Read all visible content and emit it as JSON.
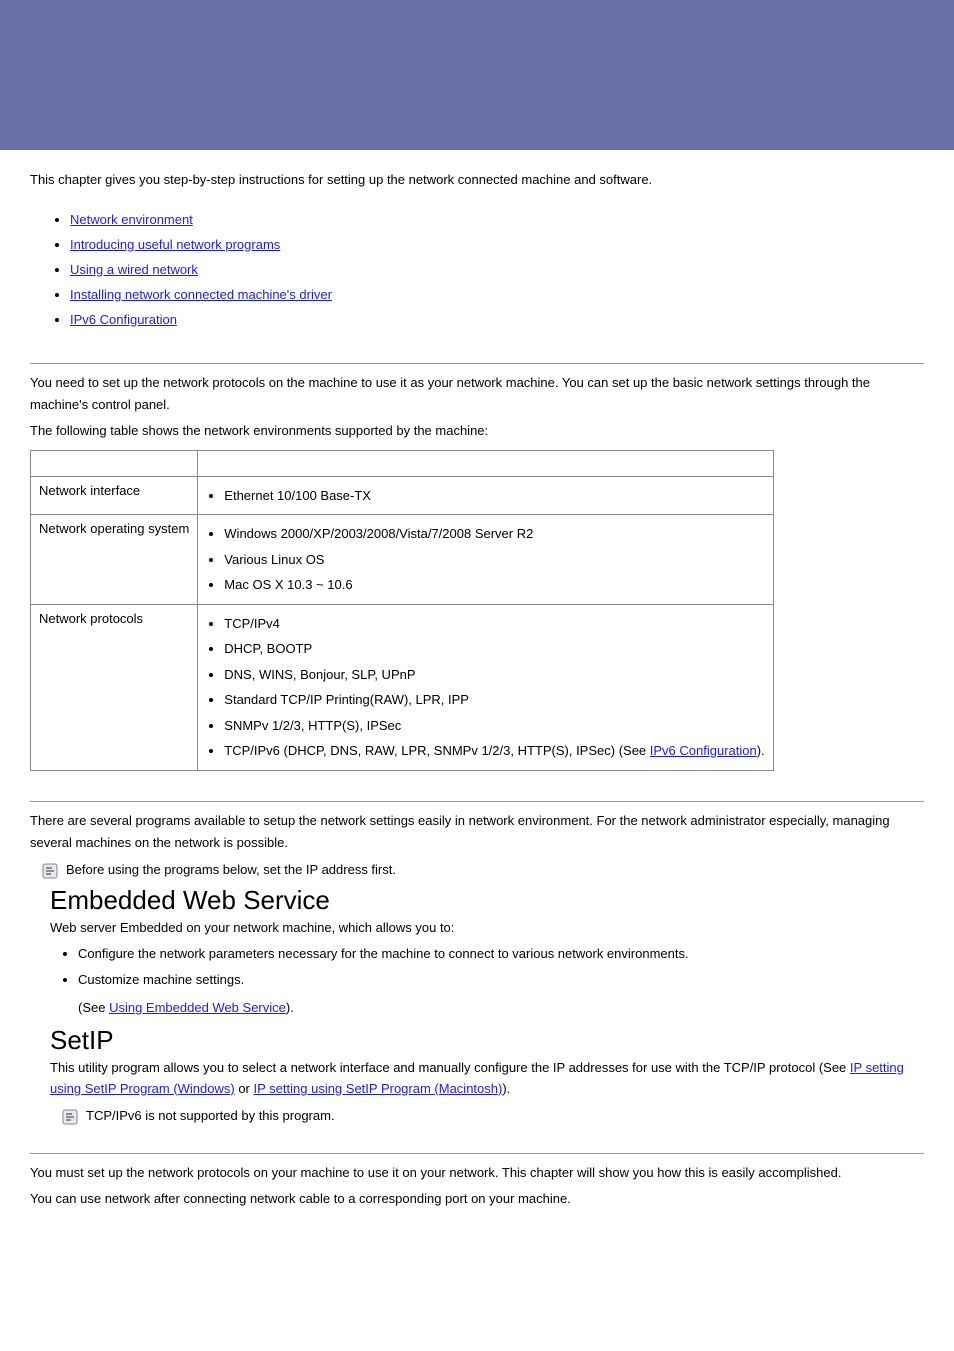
{
  "intro": "This chapter gives you step-by-step instructions for setting up the network connected machine and software.",
  "toc": [
    "Network environment",
    "Introducing useful network programs",
    "Using a wired network",
    "Installing network connected machine's driver",
    "IPv6 Configuration"
  ],
  "sec1": {
    "p1": "You need to set up the network protocols on the machine to use it as your network machine. You can set up the basic network settings through the machine's control panel.",
    "p2": "The following table shows the network environments supported by the machine:",
    "rows": [
      {
        "label": "Network interface",
        "items": [
          "Ethernet 10/100 Base-TX"
        ]
      },
      {
        "label": "Network operating system",
        "items": [
          "Windows 2000/XP/2003/2008/Vista/7/2008 Server R2",
          "Various Linux OS",
          "Mac OS X 10.3 ~ 10.6"
        ]
      },
      {
        "label": "Network protocols",
        "items": [
          "TCP/IPv4",
          "DHCP, BOOTP",
          "DNS, WINS, Bonjour, SLP, UPnP",
          "Standard TCP/IP Printing(RAW), LPR, IPP",
          "SNMPv 1/2/3, HTTP(S), IPSec"
        ],
        "last_prefix": "TCP/IPv6 (DHCP, DNS, RAW, LPR, SNMPv 1/2/3, HTTP(S), IPSec) (See ",
        "last_link": "IPv6 Configuration",
        "last_suffix": ")."
      }
    ]
  },
  "sec2": {
    "p1": "There are several programs available to setup the network settings easily in network environment. For the network administrator especially, managing several machines on the network is possible.",
    "note1": "Before using the programs below, set the IP address first.",
    "h_ews": "Embedded Web Service",
    "ews_p": "Web server Embedded on your network machine, which allows you to:",
    "ews_items": [
      "Configure the network parameters necessary for the machine to connect to various network environments.",
      "Customize machine settings."
    ],
    "ews_see_pre": "(See ",
    "ews_see_link": "Using Embedded Web Service",
    "ews_see_post": ").",
    "h_setip": "SetIP",
    "setip_p_pre": "This utility program allows you to select a network interface and manually configure the IP addresses for use with the TCP/IP protocol (See ",
    "setip_link1": "IP setting using SetIP Program (Windows)",
    "setip_mid": " or ",
    "setip_link2": "IP setting using SetIP Program (Macintosh)",
    "setip_post": ").",
    "note2": "TCP/IPv6 is not supported by this program."
  },
  "sec3": {
    "p1": "You must set up the network protocols on your machine to use it on your network. This chapter will show you how this is easily accomplished.",
    "p2": "You can use network after connecting network cable to a corresponding port on your machine."
  }
}
